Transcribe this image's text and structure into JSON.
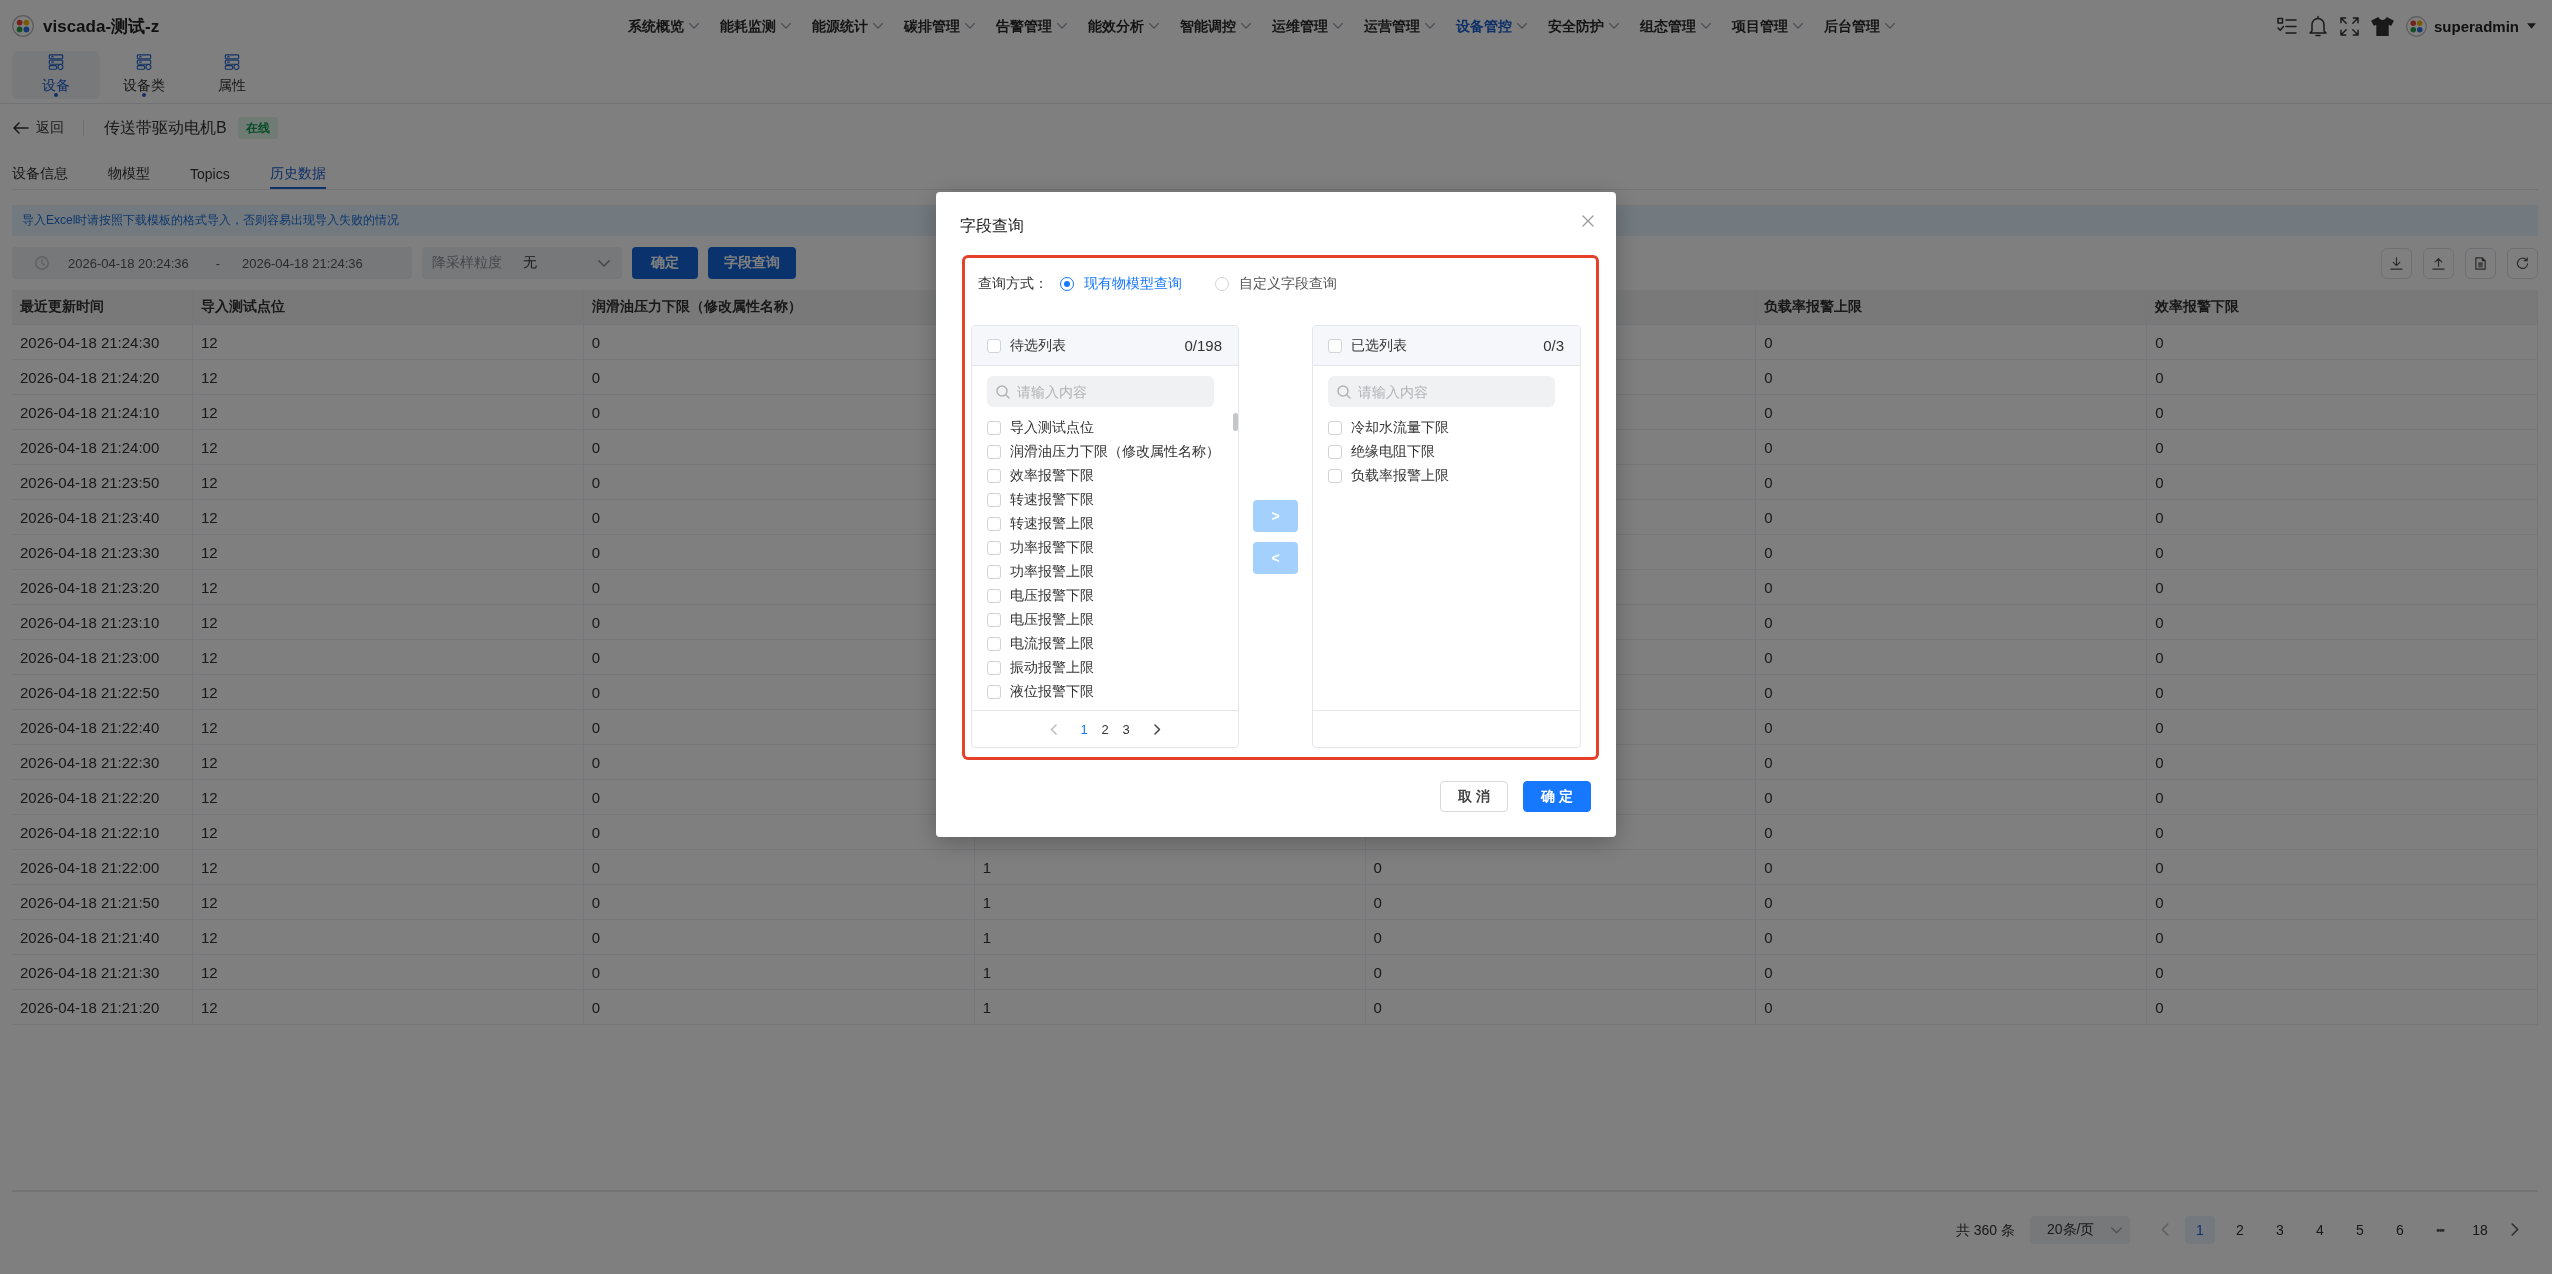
{
  "app": {
    "title": "viscada-测试-z",
    "user": "superadmin"
  },
  "nav": [
    {
      "label": "系统概览",
      "selected": false
    },
    {
      "label": "能耗监测",
      "selected": false
    },
    {
      "label": "能源统计",
      "selected": false
    },
    {
      "label": "碳排管理",
      "selected": false
    },
    {
      "label": "告警管理",
      "selected": false
    },
    {
      "label": "能效分析",
      "selected": false
    },
    {
      "label": "智能调控",
      "selected": false
    },
    {
      "label": "运维管理",
      "selected": false
    },
    {
      "label": "运营管理",
      "selected": false
    },
    {
      "label": "设备管控",
      "selected": true
    },
    {
      "label": "安全防护",
      "selected": false
    },
    {
      "label": "组态管理",
      "selected": false
    },
    {
      "label": "项目管理",
      "selected": false
    },
    {
      "label": "后台管理",
      "selected": false
    }
  ],
  "subnav": [
    {
      "label": "设备",
      "selected": true,
      "dot": true
    },
    {
      "label": "设备类",
      "selected": false,
      "dot": true
    },
    {
      "label": "属性",
      "selected": false,
      "dot": false
    }
  ],
  "device": {
    "back": "返回",
    "name": "传送带驱动电机B",
    "status": "在线"
  },
  "tabs": [
    {
      "label": "设备信息",
      "selected": false
    },
    {
      "label": "物模型",
      "selected": false
    },
    {
      "label": "Topics",
      "selected": false
    },
    {
      "label": "历史数据",
      "selected": true
    }
  ],
  "notice": "导入Excel时请按照下载模板的格式导入，否则容易出现导入失败的情况",
  "filter": {
    "start": "2026-04-18 20:24:36",
    "separator": "-",
    "end": "2026-04-18 21:24:36",
    "sampling_label": "降采样粒度",
    "sampling_value": "无",
    "buttons": [
      "确定",
      "字段查询"
    ]
  },
  "table": {
    "columns": [
      "最近更新时间",
      "导入测试点位",
      "润滑油压力下限（修改属性名称）",
      null,
      null,
      "负载率报警上限",
      "效率报警下限"
    ],
    "rows": [
      [
        "2026-04-18 21:24:30",
        "12",
        "0",
        null,
        null,
        "0",
        "0"
      ],
      [
        "2026-04-18 21:24:20",
        "12",
        "0",
        null,
        null,
        "0",
        "0"
      ],
      [
        "2026-04-18 21:24:10",
        "12",
        "0",
        null,
        null,
        "0",
        "0"
      ],
      [
        "2026-04-18 21:24:00",
        "12",
        "0",
        null,
        null,
        "0",
        "0"
      ],
      [
        "2026-04-18 21:23:50",
        "12",
        "0",
        null,
        null,
        "0",
        "0"
      ],
      [
        "2026-04-18 21:23:40",
        "12",
        "0",
        null,
        null,
        "0",
        "0"
      ],
      [
        "2026-04-18 21:23:30",
        "12",
        "0",
        null,
        null,
        "0",
        "0"
      ],
      [
        "2026-04-18 21:23:20",
        "12",
        "0",
        null,
        null,
        "0",
        "0"
      ],
      [
        "2026-04-18 21:23:10",
        "12",
        "0",
        null,
        null,
        "0",
        "0"
      ],
      [
        "2026-04-18 21:23:00",
        "12",
        "0",
        null,
        null,
        "0",
        "0"
      ],
      [
        "2026-04-18 21:22:50",
        "12",
        "0",
        null,
        null,
        "0",
        "0"
      ],
      [
        "2026-04-18 21:22:40",
        "12",
        "0",
        null,
        null,
        "0",
        "0"
      ],
      [
        "2026-04-18 21:22:30",
        "12",
        "0",
        null,
        null,
        "0",
        "0"
      ],
      [
        "2026-04-18 21:22:20",
        "12",
        "0",
        null,
        null,
        "0",
        "0"
      ],
      [
        "2026-04-18 21:22:10",
        "12",
        "0",
        null,
        null,
        "0",
        "0"
      ],
      [
        "2026-04-18 21:22:00",
        "12",
        "0",
        "1",
        "0",
        "0",
        "0"
      ],
      [
        "2026-04-18 21:21:50",
        "12",
        "0",
        "1",
        "0",
        "0",
        "0"
      ],
      [
        "2026-04-18 21:21:40",
        "12",
        "0",
        "1",
        "0",
        "0",
        "0"
      ],
      [
        "2026-04-18 21:21:30",
        "12",
        "0",
        "1",
        "0",
        "0",
        "0"
      ],
      [
        "2026-04-18 21:21:20",
        "12",
        "0",
        "1",
        "0",
        "0",
        "0"
      ]
    ]
  },
  "pagination": {
    "total": "共 360 条",
    "page_size": "20条/页",
    "prev_disabled": true,
    "next_disabled": false,
    "pages": [
      {
        "label": "1",
        "selected": true,
        "kind": "page"
      },
      {
        "label": "2",
        "selected": false,
        "kind": "page"
      },
      {
        "label": "3",
        "selected": false,
        "kind": "page"
      },
      {
        "label": "4",
        "selected": false,
        "kind": "page"
      },
      {
        "label": "5",
        "selected": false,
        "kind": "page"
      },
      {
        "label": "6",
        "selected": false,
        "kind": "page"
      },
      {
        "label": "•••",
        "kind": "more"
      },
      {
        "label": "18",
        "selected": false,
        "kind": "page"
      }
    ]
  },
  "dialog": {
    "title": "字段查询",
    "mode_label": "查询方式：",
    "modes": [
      {
        "label": "现有物模型查询",
        "selected": true
      },
      {
        "label": "自定义字段查询",
        "selected": false
      }
    ],
    "source": {
      "title": "待选列表",
      "count": "0/198",
      "all_checked": false,
      "placeholder": "请输入内容",
      "items": [
        {
          "label": "导入测试点位",
          "checked": false
        },
        {
          "label": "润滑油压力下限（修改属性名称）",
          "checked": false
        },
        {
          "label": "效率报警下限",
          "checked": false
        },
        {
          "label": "转速报警下限",
          "checked": false
        },
        {
          "label": "转速报警上限",
          "checked": false
        },
        {
          "label": "功率报警下限",
          "checked": false
        },
        {
          "label": "功率报警上限",
          "checked": false
        },
        {
          "label": "电压报警下限",
          "checked": false
        },
        {
          "label": "电压报警上限",
          "checked": false
        },
        {
          "label": "电流报警上限",
          "checked": false
        },
        {
          "label": "振动报警上限",
          "checked": false
        },
        {
          "label": "液位报警下限",
          "checked": false
        }
      ],
      "pages": [
        {
          "label": "1",
          "selected": true
        },
        {
          "label": "2",
          "selected": false
        },
        {
          "label": "3",
          "selected": false
        }
      ],
      "prev_disabled": true,
      "next_disabled": false
    },
    "target": {
      "title": "已选列表",
      "count": "0/3",
      "all_checked": false,
      "placeholder": "请输入内容",
      "items": [
        {
          "label": "冷却水流量下限",
          "checked": false
        },
        {
          "label": "绝缘电阻下限",
          "checked": false
        },
        {
          "label": "负载率报警上限",
          "checked": false
        }
      ]
    },
    "transfer_buttons": [
      {
        "label": ">",
        "disabled": true
      },
      {
        "label": "<",
        "disabled": true
      }
    ],
    "buttons": [
      {
        "label": "取 消",
        "kind": "cancel"
      },
      {
        "label": "确 定",
        "kind": "confirm"
      }
    ]
  }
}
